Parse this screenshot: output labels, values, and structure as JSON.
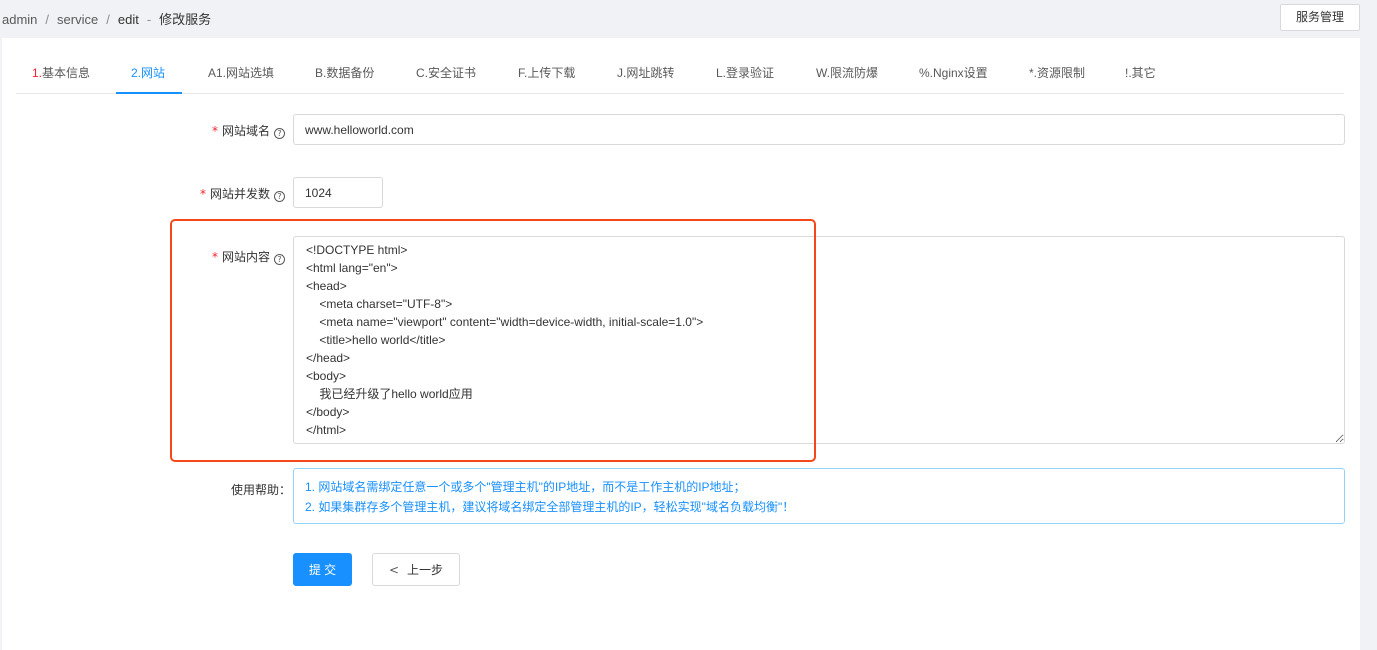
{
  "breadcrumb": {
    "items": [
      "admin",
      "service",
      "edit",
      "修改服务"
    ],
    "separator": "/"
  },
  "top_button": {
    "label": "服务管理"
  },
  "tabs": [
    {
      "prefix": "1.",
      "label": "基本信息"
    },
    {
      "prefix": "",
      "label": "2.网站"
    },
    {
      "prefix": "",
      "label": "A1.网站选填"
    },
    {
      "prefix": "",
      "label": "B.数据备份"
    },
    {
      "prefix": "",
      "label": "C.安全证书"
    },
    {
      "prefix": "",
      "label": "F.上传下载"
    },
    {
      "prefix": "",
      "label": "J.网址跳转"
    },
    {
      "prefix": "",
      "label": "L.登录验证"
    },
    {
      "prefix": "",
      "label": "W.限流防爆"
    },
    {
      "prefix": "",
      "label": "%.Nginx设置"
    },
    {
      "prefix": "",
      "label": "*.资源限制"
    },
    {
      "prefix": "",
      "label": "!.其它"
    }
  ],
  "active_tab": "2.网站",
  "form": {
    "domain": {
      "label": "网站域名",
      "value": "www.helloworld.com"
    },
    "concurrency": {
      "label": "网站并发数",
      "value": "1024"
    },
    "content": {
      "label": "网站内容",
      "value": "<!DOCTYPE html>\n<html lang=\"en\">\n<head>\n    <meta charset=\"UTF-8\">\n    <meta name=\"viewport\" content=\"width=device-width, initial-scale=1.0\">\n    <title>hello world</title>\n</head>\n<body>\n    我已经升级了hello world应用\n</body>\n</html>"
    },
    "help": {
      "label": "使用帮助",
      "lines": [
        "1. 网站域名需绑定任意一个或多个\"管理主机\"的IP地址，而不是工作主机的IP地址；",
        "2. 如果集群存多个管理主机，建议将域名绑定全部管理主机的IP，轻松实现\"域名负载均衡\"！"
      ]
    }
  },
  "buttons": {
    "submit": "提 交",
    "prev": "上一步"
  },
  "colors": {
    "primary": "#1890ff",
    "required": "#f5222d",
    "highlight": "#f5481a",
    "help_border": "#91d5ff"
  },
  "icons": {
    "help": "question-circle-icon",
    "prev": "chevron-left-icon"
  }
}
